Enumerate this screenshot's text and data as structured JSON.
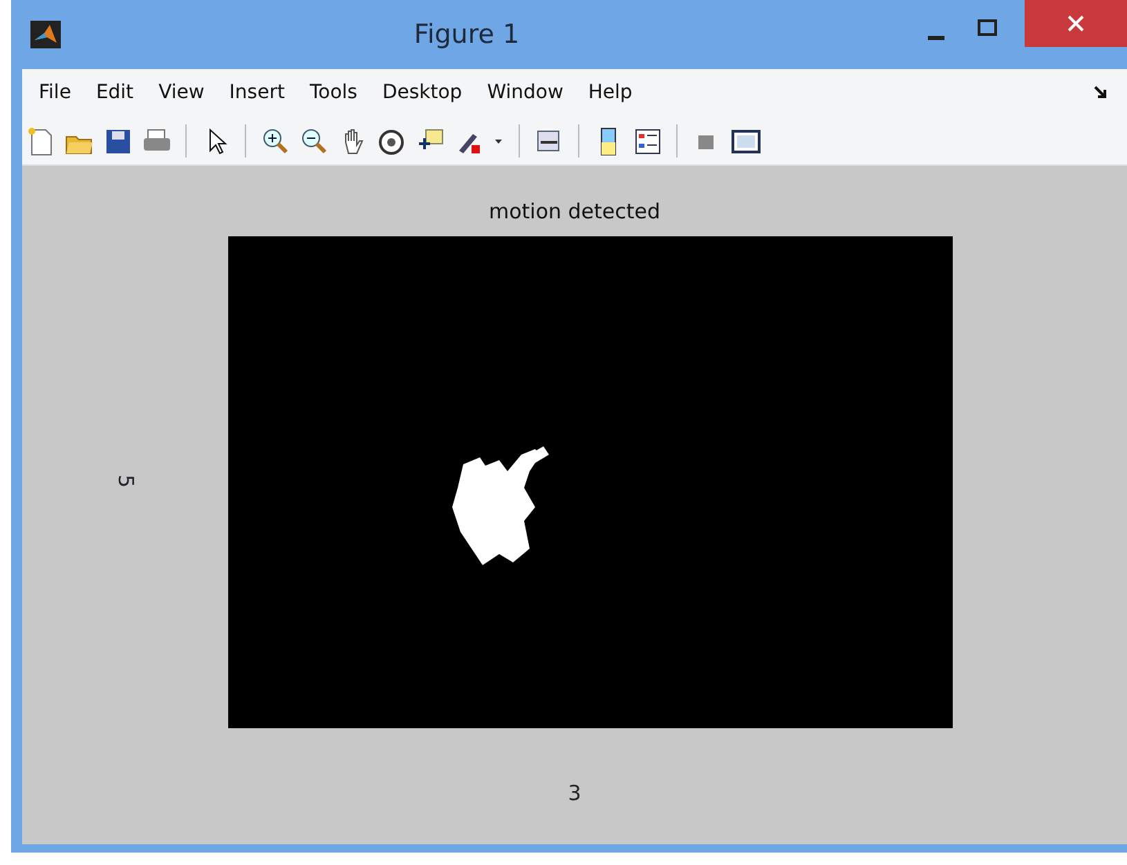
{
  "window": {
    "title": "Figure 1"
  },
  "menu": [
    {
      "label": "File"
    },
    {
      "label": "Edit"
    },
    {
      "label": "View"
    },
    {
      "label": "Insert"
    },
    {
      "label": "Tools"
    },
    {
      "label": "Desktop"
    },
    {
      "label": "Window"
    },
    {
      "label": "Help"
    }
  ],
  "axes": {
    "title": "motion detected",
    "xlabel": "3",
    "ylabel": "5"
  }
}
